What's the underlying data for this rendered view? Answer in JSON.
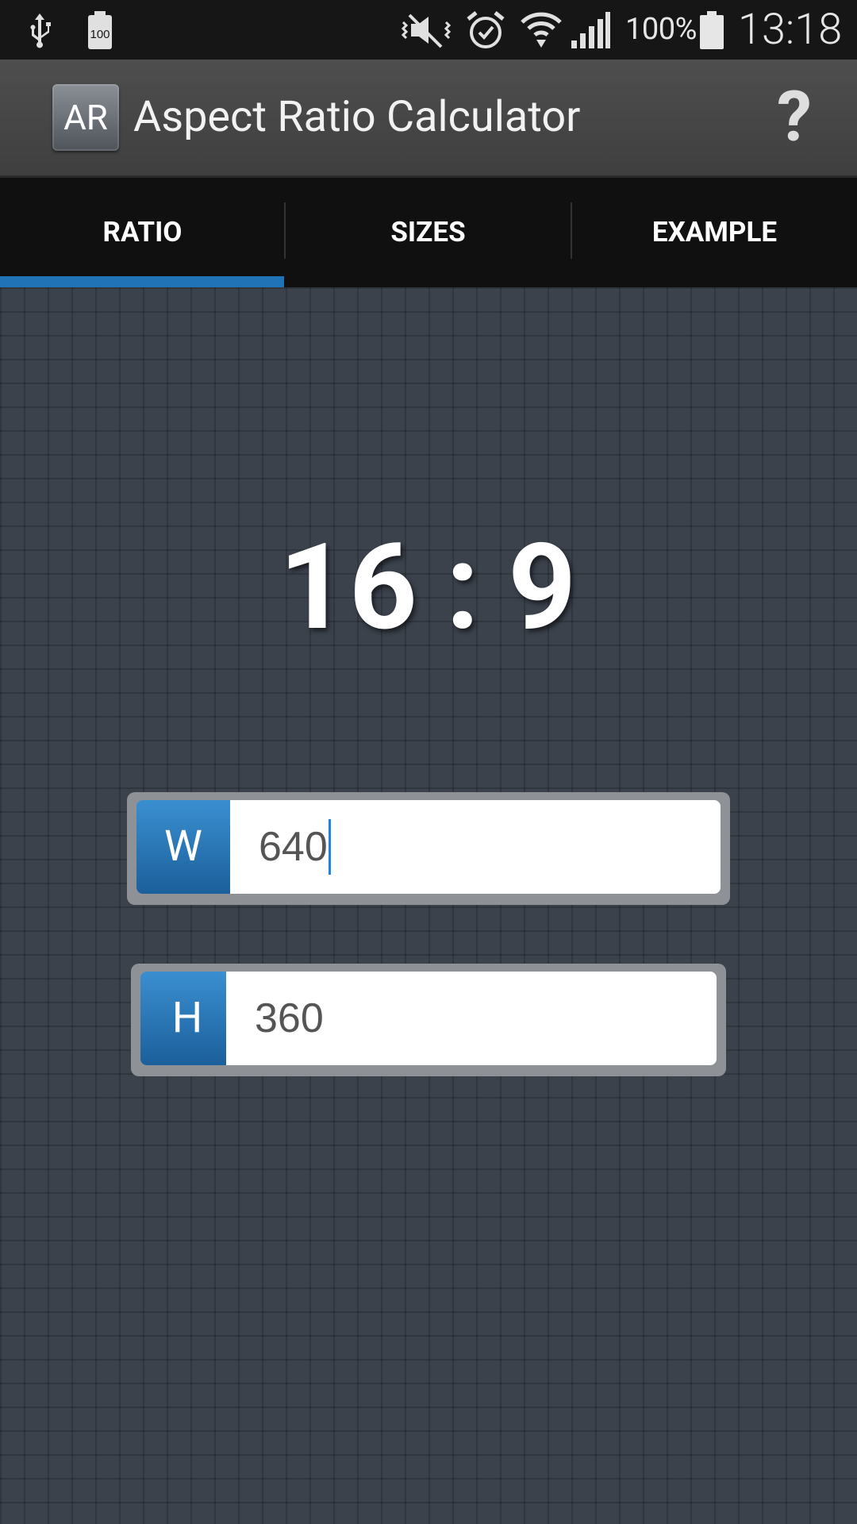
{
  "status_bar": {
    "battery_saver_badge": "100",
    "battery_percent": "100%",
    "time": "13:18",
    "icons": [
      "usb-icon",
      "battery-100-icon",
      "mute-vibrate-icon",
      "alarm-icon",
      "wifi-icon",
      "signal-icon",
      "battery-icon"
    ]
  },
  "app_bar": {
    "logo_text": "AR",
    "title": "Aspect Ratio Calculator",
    "help_label": "?"
  },
  "tabs": [
    {
      "label": "RATIO",
      "active": true
    },
    {
      "label": "SIZES",
      "active": false
    },
    {
      "label": "EXAMPLE",
      "active": false
    }
  ],
  "ratio": {
    "left": "16",
    "separator": ":",
    "right": "9"
  },
  "width_field": {
    "label": "W",
    "value": "640"
  },
  "height_field": {
    "label": "H",
    "value": "360"
  },
  "colors": {
    "accent": "#1f73b6",
    "background": "#3b424c",
    "field_label": "#2a78bb"
  }
}
